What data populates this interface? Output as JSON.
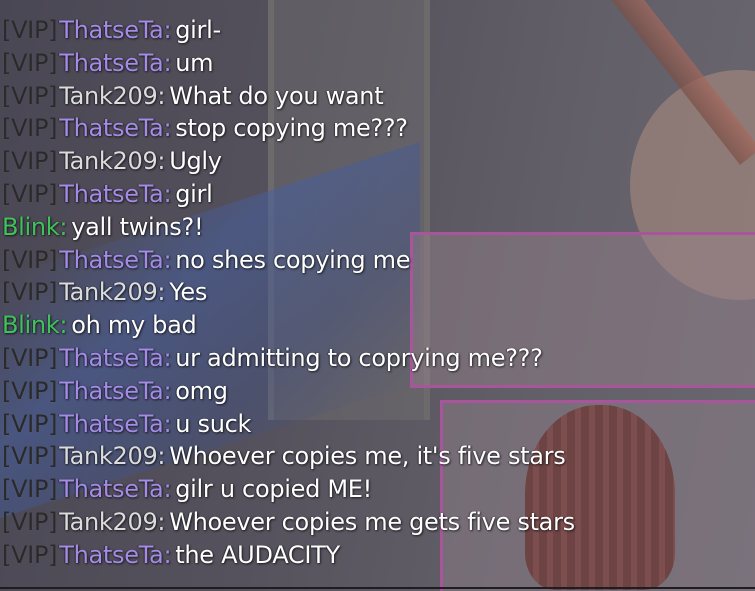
{
  "colors": {
    "vip_badge": "#2a2a2a",
    "name_thatseta": "#a58be6",
    "name_tank209": "#dcdcdc",
    "name_blink": "#3fc25a",
    "message": "#ffffff"
  },
  "chat": {
    "messages": [
      {
        "badge": "[VIP]",
        "name": "ThatseTa:",
        "name_color": "#a58be6",
        "text": "girl-"
      },
      {
        "badge": "[VIP]",
        "name": "ThatseTa:",
        "name_color": "#a58be6",
        "text": "um"
      },
      {
        "badge": "[VIP]",
        "name": "Tank209:",
        "name_color": "#dcdcdc",
        "text": "What do you want"
      },
      {
        "badge": "[VIP]",
        "name": "ThatseTa:",
        "name_color": "#a58be6",
        "text": "stop copying me???"
      },
      {
        "badge": "[VIP]",
        "name": "Tank209:",
        "name_color": "#dcdcdc",
        "text": "Ugly"
      },
      {
        "badge": "[VIP]",
        "name": "ThatseTa:",
        "name_color": "#a58be6",
        "text": "girl"
      },
      {
        "badge": "",
        "name": "Blink:",
        "name_color": "#3fc25a",
        "text": "yall twins?!"
      },
      {
        "badge": "[VIP]",
        "name": "ThatseTa:",
        "name_color": "#a58be6",
        "text": "no shes copying me"
      },
      {
        "badge": "[VIP]",
        "name": "Tank209:",
        "name_color": "#dcdcdc",
        "text": "Yes"
      },
      {
        "badge": "",
        "name": "Blink:",
        "name_color": "#3fc25a",
        "text": "oh my bad"
      },
      {
        "badge": "[VIP]",
        "name": "ThatseTa:",
        "name_color": "#a58be6",
        "text": "ur admitting to coprying me???"
      },
      {
        "badge": "[VIP]",
        "name": "ThatseTa:",
        "name_color": "#a58be6",
        "text": "omg"
      },
      {
        "badge": "[VIP]",
        "name": "ThatseTa:",
        "name_color": "#a58be6",
        "text": "u suck"
      },
      {
        "badge": "[VIP]",
        "name": "Tank209:",
        "name_color": "#dcdcdc",
        "text": "Whoever copies me, it's five stars"
      },
      {
        "badge": "[VIP]",
        "name": "ThatseTa:",
        "name_color": "#a58be6",
        "text": "gilr u copied ME!"
      },
      {
        "badge": "[VIP]",
        "name": "Tank209:",
        "name_color": "#dcdcdc",
        "text": "Whoever copies me gets five stars"
      },
      {
        "badge": "[VIP]",
        "name": "ThatseTa:",
        "name_color": "#a58be6",
        "text": "the AUDACITY"
      }
    ]
  }
}
